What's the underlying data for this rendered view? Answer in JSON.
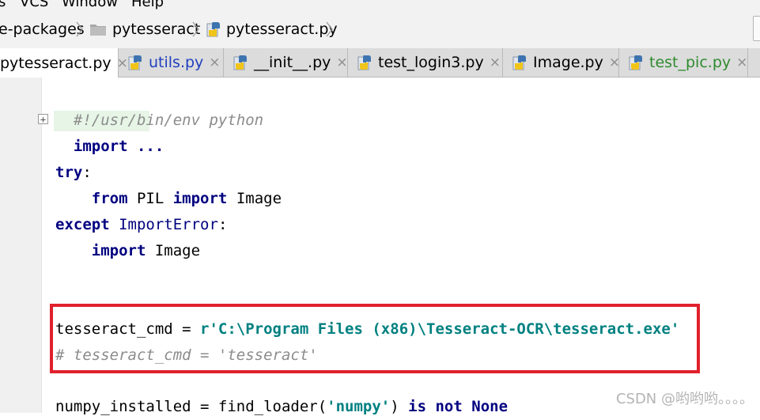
{
  "menu": {
    "items": [
      "s",
      "VCS",
      "Window",
      "Help"
    ]
  },
  "breadcrumb": {
    "items": [
      "e-packages",
      "pytesseract",
      "pytesseract.py"
    ]
  },
  "tabs": [
    {
      "label": "pytesseract.py",
      "active": true,
      "color": "#000000"
    },
    {
      "label": "utils.py",
      "active": false,
      "color": "#1f3fbf"
    },
    {
      "label": "__init__.py",
      "active": false,
      "color": "#000000"
    },
    {
      "label": "test_login3.py",
      "active": false,
      "color": "#000000"
    },
    {
      "label": "Image.py",
      "active": false,
      "color": "#000000"
    },
    {
      "label": "test_pic.py",
      "active": false,
      "color": "#2e8b2e"
    }
  ],
  "tab_close_glyph": "×",
  "code": {
    "shebang": "#!/usr/bin/env python",
    "import_fold": "import ...",
    "try_kw": "try",
    "try_colon": ":",
    "from_kw": "from",
    "pil": " PIL ",
    "import_kw": "import",
    "image": " Image",
    "except_kw": "except",
    "import_error": "ImportError",
    "except_colon": ":",
    "import2_kw": "import",
    "image2": " Image",
    "tess_assign": "tesseract_cmd = ",
    "tess_value": "r'C:\\Program Files (x86)\\Tesseract-OCR\\tesseract.exe'",
    "tess_comment": "# tesseract_cmd = 'tesseract'",
    "numpy_line_a": "numpy_installed = find_loader(",
    "numpy_str": "'numpy'",
    "numpy_line_b": ") ",
    "is_kw": "is",
    "not_kw": "not",
    "none_kw": "None"
  },
  "watermark": "CSDN @哟哟哟。。。。",
  "colors": {
    "highlight": "#e0202c",
    "keyword": "#000080",
    "string": "#008080",
    "comment": "#8c8c8c"
  }
}
